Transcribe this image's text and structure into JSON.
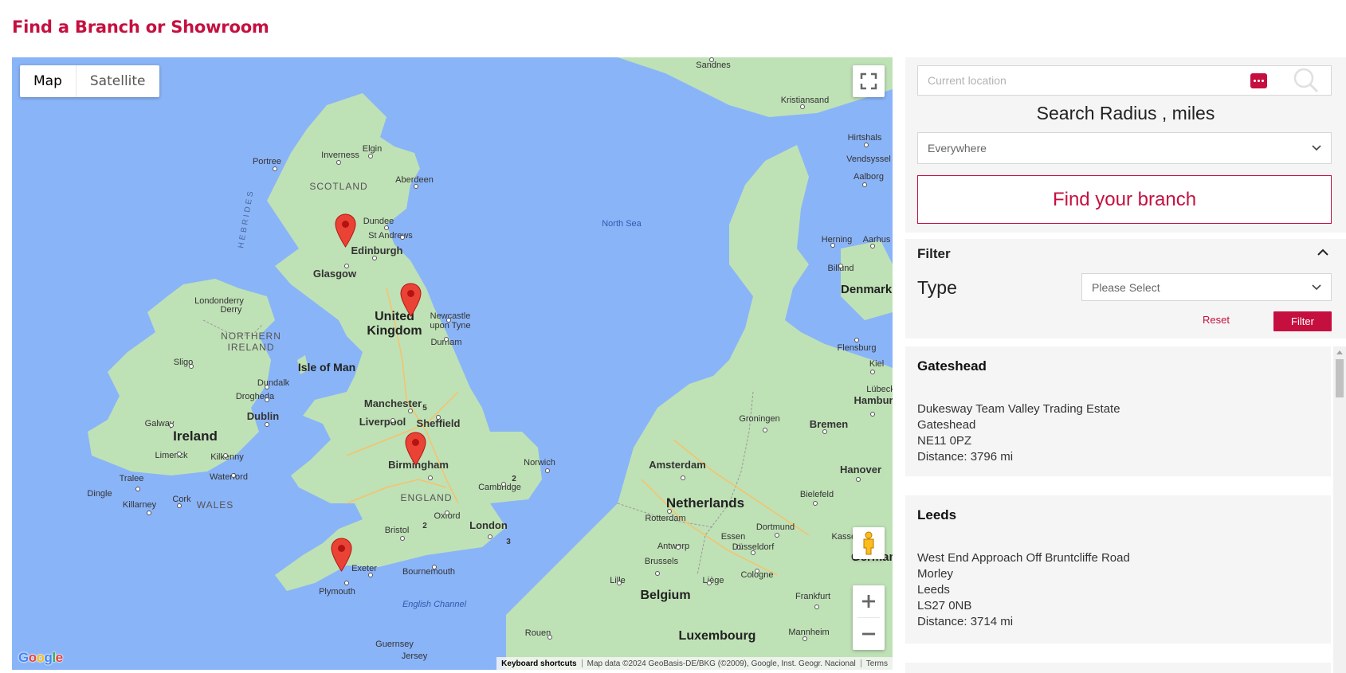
{
  "page": {
    "title": "Find a Branch or Showroom"
  },
  "map": {
    "type_control": {
      "map_label": "Map",
      "satellite_label": "Satellite",
      "active": "Map"
    },
    "labels": {
      "countries": [
        "United Kingdom",
        "Ireland",
        "Netherlands",
        "Belgium",
        "Luxembourg",
        "Denmark",
        "German"
      ],
      "regions": [
        "SCOTLAND",
        "NORTHERN IRELAND",
        "WALES",
        "ENGLAND",
        "HEBRIDES",
        "Isle of Man"
      ],
      "cities": [
        "Edinburgh",
        "Glasgow",
        "Dundee",
        "St Andrews",
        "Aberdeen",
        "Inverness",
        "Elgin",
        "Portree",
        "Newcastle upon Tyne",
        "Durham",
        "Manchester",
        "Liverpool",
        "Sheffield",
        "Birmingham",
        "Cambridge",
        "Norwich",
        "Oxford",
        "London",
        "Bristol",
        "Bournemouth",
        "Plymouth",
        "Exeter",
        "Dublin",
        "Dundalk",
        "Drogheda",
        "Galway",
        "Limerick",
        "Kilkenny",
        "Waterford",
        "Cork",
        "Tralee",
        "Killarney",
        "Dingle",
        "Sligo",
        "Derry",
        "Londonderry",
        "Sandnes",
        "Kristiansand",
        "Hirtshals",
        "Vendsyssel",
        "Aalborg",
        "Herning",
        "Aarhus",
        "Billund",
        "Flensburg",
        "Kiel",
        "Lübeck",
        "Hamburg",
        "Bremen",
        "Groningen",
        "Amsterdam",
        "Rotterdam",
        "Hanover",
        "Bielefeld",
        "Dortmund",
        "Essen",
        "Düsseldorf",
        "Kassel",
        "Antwerp",
        "Brussels",
        "Cologne",
        "Lille",
        "Liège",
        "Frankfurt",
        "Mannheim",
        "Rouen",
        "Guernsey",
        "Jersey"
      ],
      "water": [
        "North Sea",
        "English Channel"
      ],
      "roads": [
        "5",
        "2",
        "2",
        "3"
      ]
    },
    "marker_count": 4,
    "attribution": {
      "keyboard": "Keyboard shortcuts",
      "data": "Map data ©2024 GeoBasis-DE/BKG (©2009), Google, Inst. Geogr. Nacional",
      "terms": "Terms"
    },
    "logo": "Google",
    "colors": {
      "water": "#8ab4f8",
      "land": "#bfe1b6",
      "marker": "#ea4335"
    },
    "icons": [
      "fullscreen-icon",
      "pegman-icon",
      "plus-icon",
      "minus-icon",
      "map-marker-icon"
    ]
  },
  "search": {
    "location_placeholder": "Current location",
    "radius_title": "Search Radius , miles",
    "radius_value": "Everywhere",
    "find_button": "Find your branch"
  },
  "filter": {
    "title": "Filter",
    "type_label": "Type",
    "type_placeholder": "Please Select",
    "reset_label": "Reset",
    "filter_button": "Filter"
  },
  "results": [
    {
      "name": "Gateshead",
      "lines": [
        "Dukesway Team Valley Trading Estate",
        "Gateshead",
        "NE11 0PZ",
        "Distance: 3796 mi"
      ]
    },
    {
      "name": "Leeds",
      "lines": [
        "West End Approach Off Bruntcliffe Road",
        "Morley",
        "Leeds",
        "LS27 0NB",
        "Distance: 3714 mi"
      ]
    }
  ],
  "theme": {
    "accent": "#c5103f",
    "panel_bg": "#f5f5f5"
  }
}
